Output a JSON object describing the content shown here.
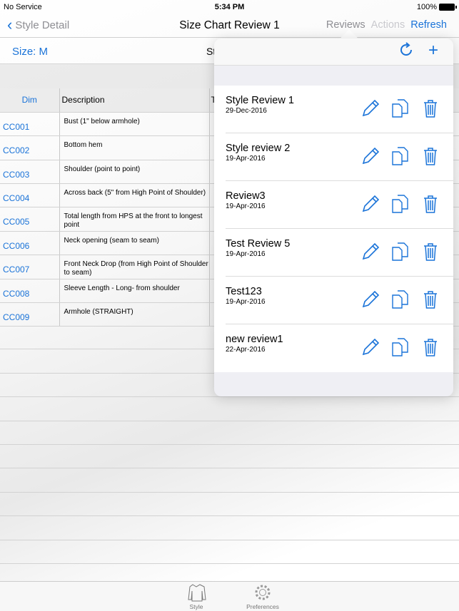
{
  "status": {
    "carrier": "No Service",
    "time": "5:34 PM",
    "battery": "100%"
  },
  "nav": {
    "back": "Style Detail",
    "title": "Size Chart Review 1",
    "reviews": "Reviews",
    "actions": "Actions",
    "refresh": "Refresh"
  },
  "sizebar": {
    "size": "Size: M",
    "partial": "St"
  },
  "table": {
    "headers": [
      "Dim",
      "Description",
      "T"
    ],
    "rows": [
      {
        "dim": "CC001",
        "desc": "Bust (1\" below armhole)"
      },
      {
        "dim": "CC002",
        "desc": "Bottom hem"
      },
      {
        "dim": "CC003",
        "desc": "Shoulder (point to point)"
      },
      {
        "dim": "CC004",
        "desc": "Across back (5\" from High Point of Shoulder)"
      },
      {
        "dim": "CC005",
        "desc": "Total length from HPS at the front to longest point"
      },
      {
        "dim": "CC006",
        "desc": "Neck opening (seam to seam)"
      },
      {
        "dim": "CC007",
        "desc": "Front Neck Drop (from High Point of Shoulder to seam)"
      },
      {
        "dim": "CC008",
        "desc": "Sleeve Length - Long- from shoulder"
      },
      {
        "dim": "CC009",
        "desc": "Armhole (STRAIGHT)"
      }
    ]
  },
  "popover": {
    "reviews": [
      {
        "name": "Style Review 1",
        "date": "29-Dec-2016"
      },
      {
        "name": "Style review 2",
        "date": "19-Apr-2016"
      },
      {
        "name": "Review3",
        "date": "19-Apr-2016"
      },
      {
        "name": "Test Review 5",
        "date": "19-Apr-2016"
      },
      {
        "name": "Test123",
        "date": "19-Apr-2016"
      },
      {
        "name": "new review1",
        "date": "22-Apr-2016"
      }
    ]
  },
  "tabbar": {
    "style": "Style",
    "preferences": "Preferences"
  },
  "colors": {
    "accent": "#1a73d8"
  }
}
